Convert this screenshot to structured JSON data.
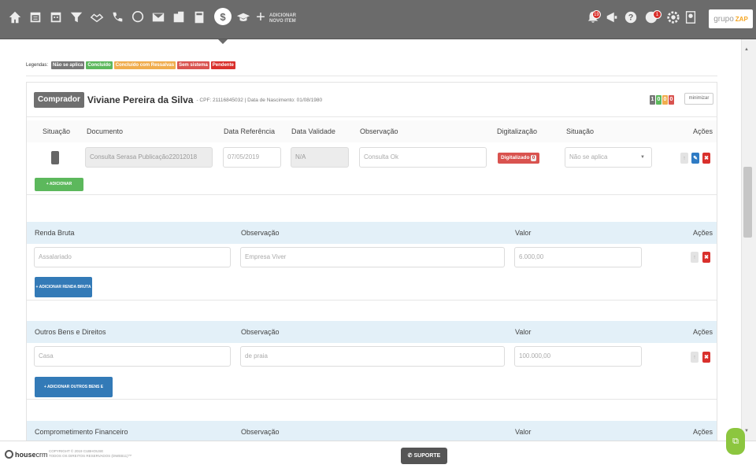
{
  "nav": {
    "new_item_line1": "ADICIONAR",
    "new_item_line2": "NOVO ITEM",
    "notif_badge": "19",
    "alert_badge": "1",
    "logo_text": "grupo",
    "logo_brand": "ZAP"
  },
  "legend": {
    "label": "Legendas:",
    "items": [
      {
        "label": "Não se aplica",
        "color": "#777777"
      },
      {
        "label": "Concluído",
        "color": "#5cb85c"
      },
      {
        "label": "Concluído com Ressalvas",
        "color": "#f0ad4e"
      },
      {
        "label": "Sem sistema",
        "color": "#d9534f"
      },
      {
        "label": "Pendente",
        "color": "#d9302c"
      }
    ]
  },
  "buyer": {
    "tag": "Comprador",
    "name": "Viviane Pereira da Silva",
    "info": "- CPF: 21116845032 | Data de Nascimento: 01/08/1980",
    "counters": [
      {
        "value": "1",
        "color": "#777777"
      },
      {
        "value": "0",
        "color": "#5cb85c"
      },
      {
        "value": "0",
        "color": "#f0ad4e"
      },
      {
        "value": "0",
        "color": "#d9534f"
      }
    ],
    "minimize_label": "minimizar"
  },
  "documents": {
    "headers": {
      "situacao": "Situação",
      "documento": "Documento",
      "data_ref": "Data Referência",
      "data_val": "Data Validade",
      "obs": "Observação",
      "digitalizacao": "Digitalização",
      "situacao2": "Situação",
      "acoes": "Ações"
    },
    "row": {
      "documento": "Consulta Serasa Publicação22012018",
      "data_ref": "07/05/2019",
      "data_val": "N/A",
      "obs": "Consulta Ok",
      "digitalizado": "Digitalizado",
      "digitalizado_count": "0",
      "situacao": "Não se aplica"
    },
    "add_button": "+ ADICIONAR DOCUMENTO"
  },
  "renda": {
    "headers": {
      "col1": "Renda Bruta",
      "col2": "Observação",
      "col3": "Valor",
      "acoes": "Ações"
    },
    "row": {
      "col1": "Assalariado",
      "col2": "Empresa Viver",
      "col3": "6.000,00"
    },
    "add_button": "+ ADICIONAR RENDA BRUTA"
  },
  "bens": {
    "headers": {
      "col1": "Outros Bens e Direitos",
      "col2": "Observação",
      "col3": "Valor",
      "acoes": "Ações"
    },
    "row": {
      "col1": "Casa",
      "col2": "de praia",
      "col3": "100.000,00"
    },
    "add_button": "+ ADICIONAR OUTROS BENS E DIREITOS"
  },
  "comprometimento": {
    "headers": {
      "col1": "Comprometimento Financeiro",
      "col2": "Observação",
      "col3": "Valor",
      "acoes": "Ações"
    }
  },
  "footer": {
    "brand": "house",
    "brand_suffix": "crm",
    "copy_line1": "COPYRIGHT © 2019 CUBHOUSE",
    "copy_line2": "TODOS OS DIREITOS RESERVADOS (DWEB11)™",
    "support": "SUPORTE"
  }
}
